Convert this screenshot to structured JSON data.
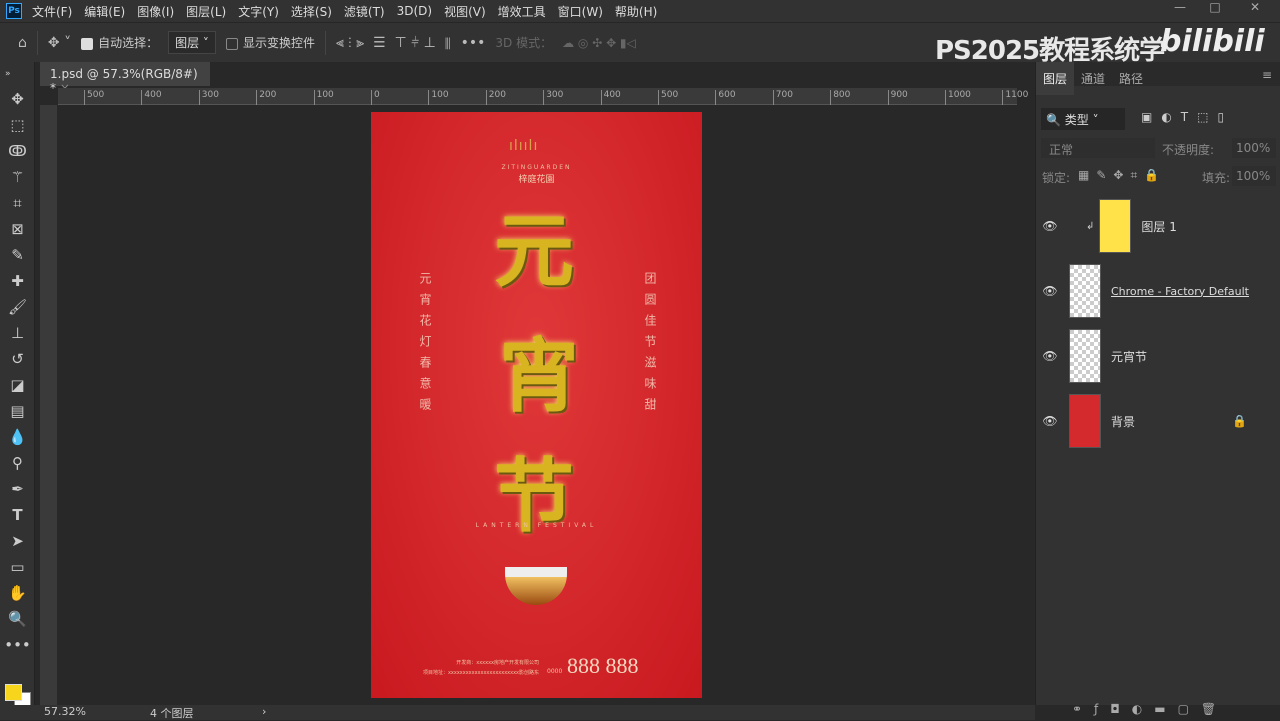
{
  "app": {
    "logo": "Ps",
    "menu": [
      "文件(F)",
      "编辑(E)",
      "图像(I)",
      "图层(L)",
      "文字(Y)",
      "选择(S)",
      "滤镜(T)",
      "3D(D)",
      "视图(V)",
      "增效工具",
      "窗口(W)",
      "帮助(H)"
    ]
  },
  "options": {
    "auto_select_label": "自动选择：",
    "auto_select_target": "图层",
    "show_transform_label": "显示变换控件",
    "mode_3d_label": "3D 模式："
  },
  "watermark": {
    "text": "PS2025教程系统学",
    "brand": "bilibili"
  },
  "document_tab": {
    "title": "1.psd @ 57.3%(RGB/8#) *",
    "close": "×"
  },
  "ruler_labels": [
    "500",
    "400",
    "300",
    "200",
    "100",
    "0",
    "100",
    "200",
    "300",
    "400",
    "500",
    "600",
    "700",
    "800",
    "900",
    "1000",
    "1100"
  ],
  "poster": {
    "brand_en": "ZITINGUARDEN",
    "brand_cn": "梓庭花園",
    "title_chars": [
      "元",
      "宵",
      "节"
    ],
    "left_verse": "元宵花灯春意暖",
    "right_verse": "团圆佳节滋味甜",
    "subtitle": "LANTERN FESTIVAL",
    "dev_line": "开发商：xxxxxx房地产开发有限公司",
    "addr_line": "项目地址：xxxxxxxxxxxxxxxxxxxxxxxx影创路东",
    "phone_prefix": "0000",
    "phone": "888 888"
  },
  "layers_panel": {
    "tabs": [
      "图层",
      "通道",
      "路径"
    ],
    "filter": "类型",
    "blend_mode": "正常",
    "opacity_label": "不透明度:",
    "opacity": "100%",
    "lock_label": "锁定:",
    "fill_label": "填充:",
    "fill": "100%",
    "layers": [
      {
        "name": "图层 1",
        "clipped": true,
        "color": "#ffe14a"
      },
      {
        "name": "Chrome - Factory Default"
      },
      {
        "name": "元宵节"
      },
      {
        "name": "背景",
        "locked": true
      }
    ]
  },
  "status": {
    "zoom": "57.32%",
    "info": "4 个图层"
  },
  "colors": {
    "foreground": "#f7d51d",
    "background": "#ffffff",
    "poster_red": "#d42a2e"
  }
}
